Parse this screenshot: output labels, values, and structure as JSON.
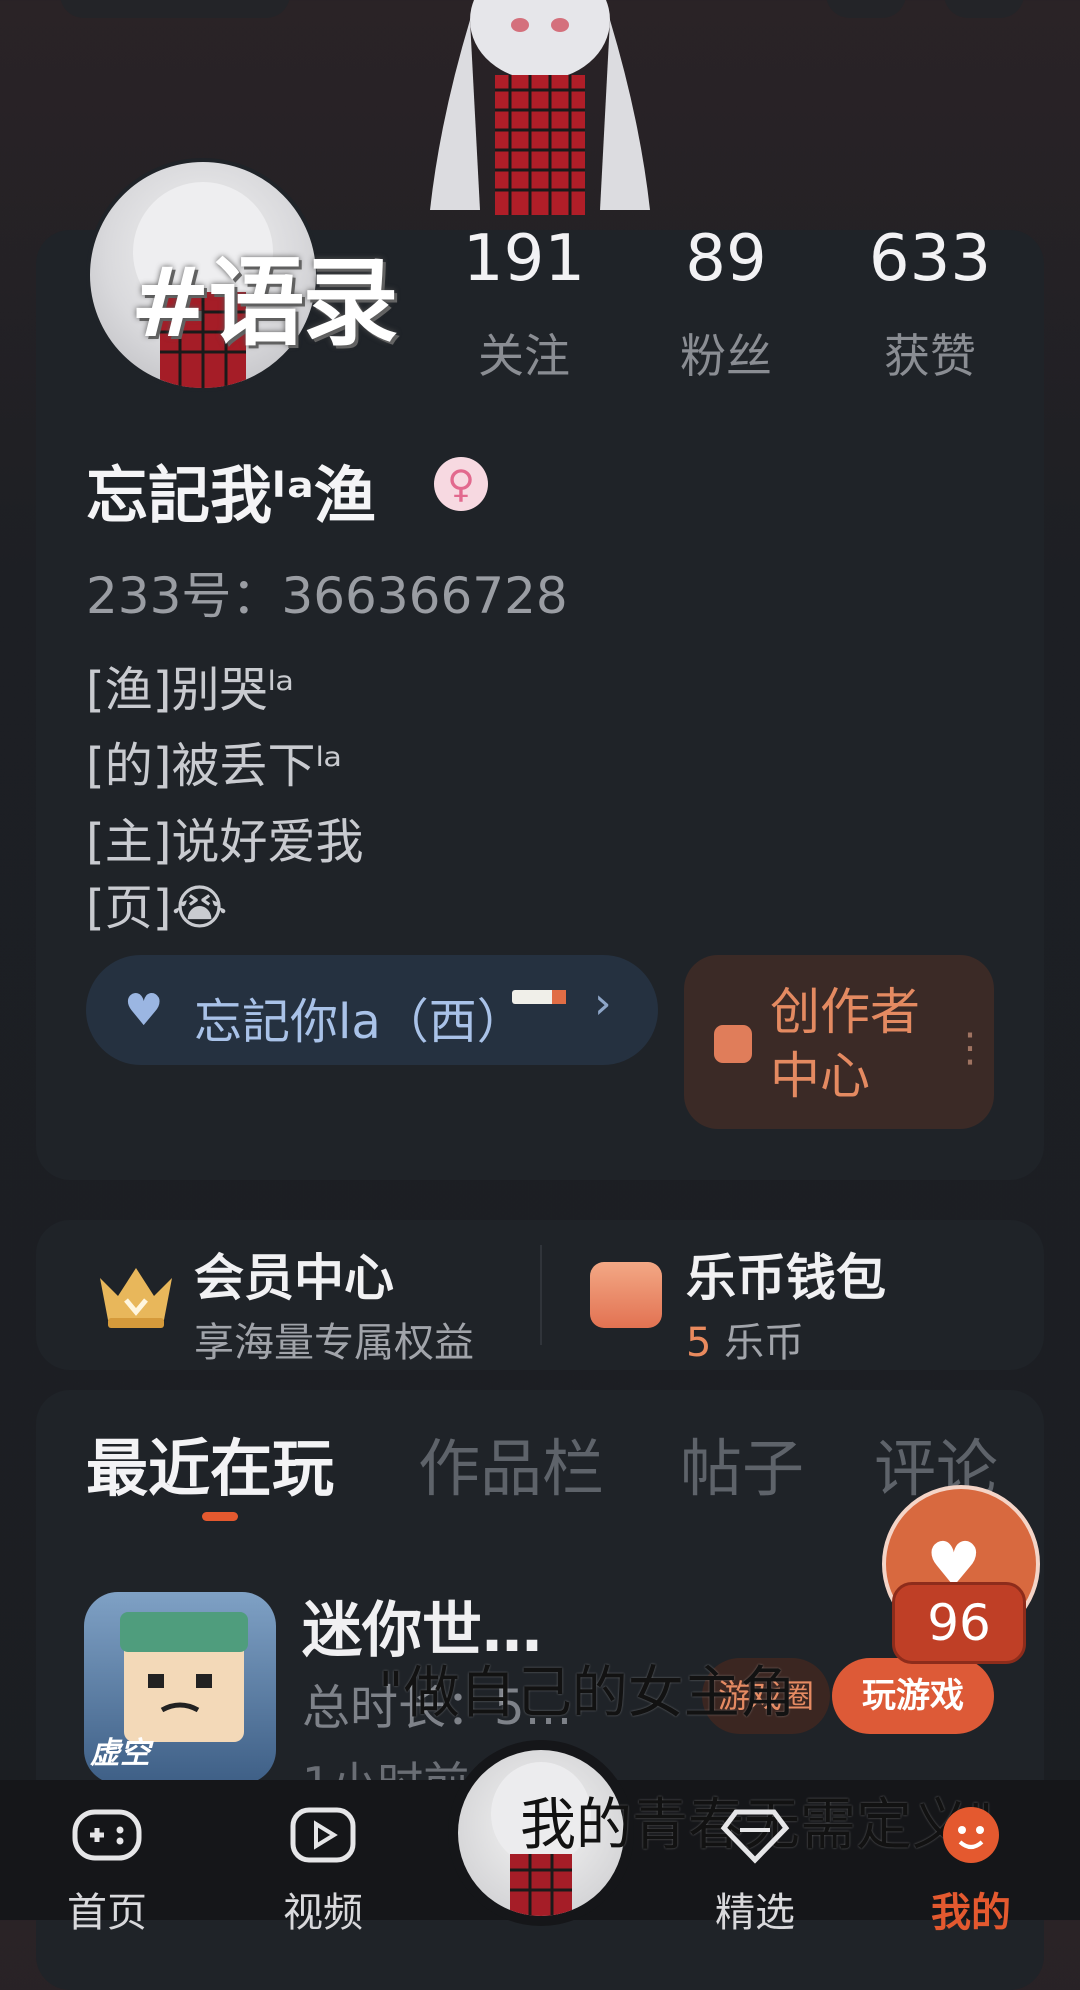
{
  "profile": {
    "avatar_title": "#语录",
    "name": "忘記我ˡᵃ渔",
    "gender_symbol": "♀",
    "uid": "233号：366366728",
    "bio": [
      "[渔]别哭ˡᵃ",
      "[的]被丢下ˡᵃ",
      "[主]说好爱我",
      "[页]😭"
    ]
  },
  "stats": [
    {
      "value": "191",
      "label": "关注"
    },
    {
      "value": "89",
      "label": "粉丝"
    },
    {
      "value": "633",
      "label": "获赞"
    }
  ],
  "tag": {
    "text": "忘記你la（西）",
    "chevron": "›"
  },
  "creator": {
    "label_line1": "创作者",
    "label_line2": "中心",
    "dots": "⋮"
  },
  "vip": {
    "title": "会员中心",
    "subtitle": "享海量专属权益"
  },
  "wallet": {
    "title": "乐币钱包",
    "coins": "5",
    "unit": "乐币"
  },
  "tabs": [
    "最近在玩",
    "作品栏",
    "帖子",
    "评论"
  ],
  "game": {
    "title": "迷你世…",
    "time": "总时长：5…",
    "last": "1小时前",
    "circle_button": "游戏圈",
    "play_button": "玩游戏",
    "icon_text": "虚空"
  },
  "like": {
    "count": "96"
  },
  "overlay": {
    "line1": "\"做自己的女主角",
    "line2": "我的青春无需定义\""
  },
  "nav": [
    {
      "label": "首页",
      "icon": "gamepad-icon"
    },
    {
      "label": "视频",
      "icon": "play-icon"
    },
    {
      "label": "精选",
      "icon": "diamond-icon"
    },
    {
      "label": "我的",
      "icon": "profile-icon"
    }
  ],
  "colors": {
    "accent": "#e4592f",
    "background": "#1b1e22",
    "card": "#1f2328",
    "link": "#a9c2e8"
  }
}
